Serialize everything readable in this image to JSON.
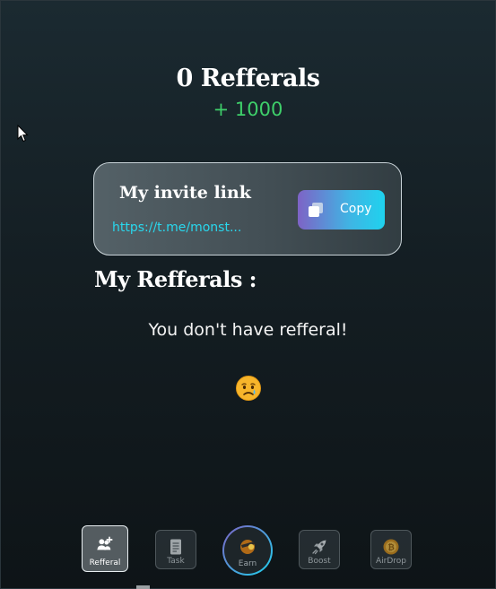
{
  "summary": {
    "referral_count_label": "0 Refferals",
    "bonus_label": "+ 1000"
  },
  "invite": {
    "heading": "My invite link",
    "link": "https://t.me/monst...",
    "copy_label": "Copy"
  },
  "referrals": {
    "section_title": "My Refferals :",
    "empty_message": "You don't have refferal!",
    "empty_icon": "crying-face-emoji"
  },
  "nav": {
    "items": [
      {
        "label": "Refferal",
        "icon": "add-user-icon",
        "active": true
      },
      {
        "label": "Task",
        "icon": "document-icon",
        "active": false
      },
      {
        "label": "Earn",
        "icon": "earn-icon",
        "active": false
      },
      {
        "label": "Boost",
        "icon": "rocket-icon",
        "active": false
      },
      {
        "label": "AirDrop",
        "icon": "coin-icon",
        "active": false
      }
    ]
  },
  "colors": {
    "bonus": "#3ecf6a",
    "link": "#28d8ee",
    "copy_gradient_start": "#7e63c6",
    "copy_gradient_end": "#1fd2ee"
  }
}
